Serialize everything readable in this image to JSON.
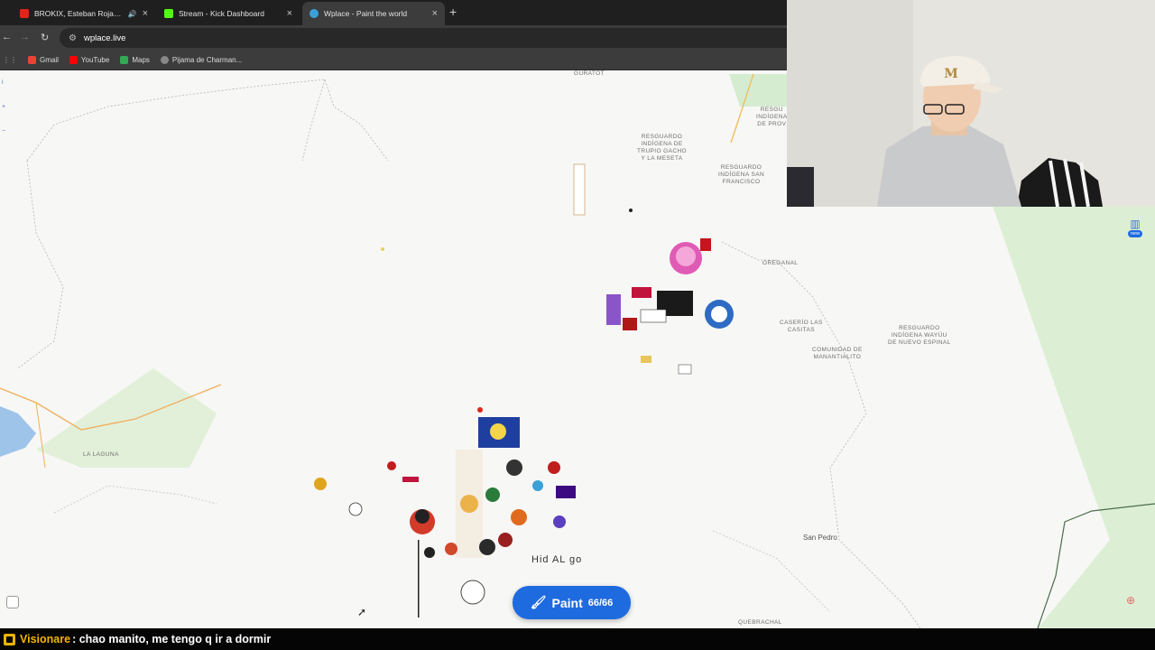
{
  "browser": {
    "tabs": [
      {
        "label": "BROKIX, Esteban Rojas, Feid",
        "favicon_color": "#e0251b",
        "active": false,
        "muted_icon": "speaker-icon"
      },
      {
        "label": "Stream - Kick Dashboard",
        "favicon_color": "#53fc18",
        "active": false
      },
      {
        "label": "Wplace - Paint the world",
        "favicon_color": "#3aa0d8",
        "active": true
      }
    ],
    "url": "wplace.live",
    "bookmarks": [
      {
        "label": "Gmail",
        "icon": "gmail-icon",
        "color": "#ea4335"
      },
      {
        "label": "YouTube",
        "icon": "youtube-icon",
        "color": "#ff0000"
      },
      {
        "label": "Maps",
        "icon": "maps-icon",
        "color": "#34a853"
      },
      {
        "label": "Pijama de Charman...",
        "icon": "link-icon",
        "color": "#bbbbbb"
      }
    ]
  },
  "map": {
    "places": [
      {
        "label": "RESGUARDO\nINDÍGENA DE\nTRUPIO GACHO\nY LA MESETA",
        "kind": "area"
      },
      {
        "label": "RESGUARDO\nINDÍGENA SAN\nFRANCISCO",
        "kind": "area"
      },
      {
        "label": "RESGU\nINDÍGENA\nDE PROV",
        "kind": "area"
      },
      {
        "label": "OREGANAL",
        "kind": "area"
      },
      {
        "label": "CASERÍO LAS\nCASITAS",
        "kind": "area"
      },
      {
        "label": "RESGUARDO\nINDÍGENA WAYÚU\nDE NUEVO ESPINAL",
        "kind": "area"
      },
      {
        "label": "COMUNIDAD DE\nMANANTIALITO",
        "kind": "area"
      },
      {
        "label": "LA LAGUNA",
        "kind": "area"
      },
      {
        "label": "San Pedro",
        "kind": "town"
      },
      {
        "label": "QUEBRACHAL",
        "kind": "area"
      },
      {
        "label": "GURATOT",
        "kind": "area"
      }
    ],
    "caption": "Hid AL go",
    "paint_button": {
      "label": "Paint",
      "count": "66/66"
    },
    "stats_badge": "new",
    "colors": {
      "accent": "#1e6be0",
      "road": "#f0a948",
      "water": "#9fc4ea",
      "park": "#d9ecd0"
    }
  },
  "chat": {
    "user": "Visionare",
    "message": ": chao manito, me tengo q ir a dormir",
    "user_color": "#f4b400"
  }
}
